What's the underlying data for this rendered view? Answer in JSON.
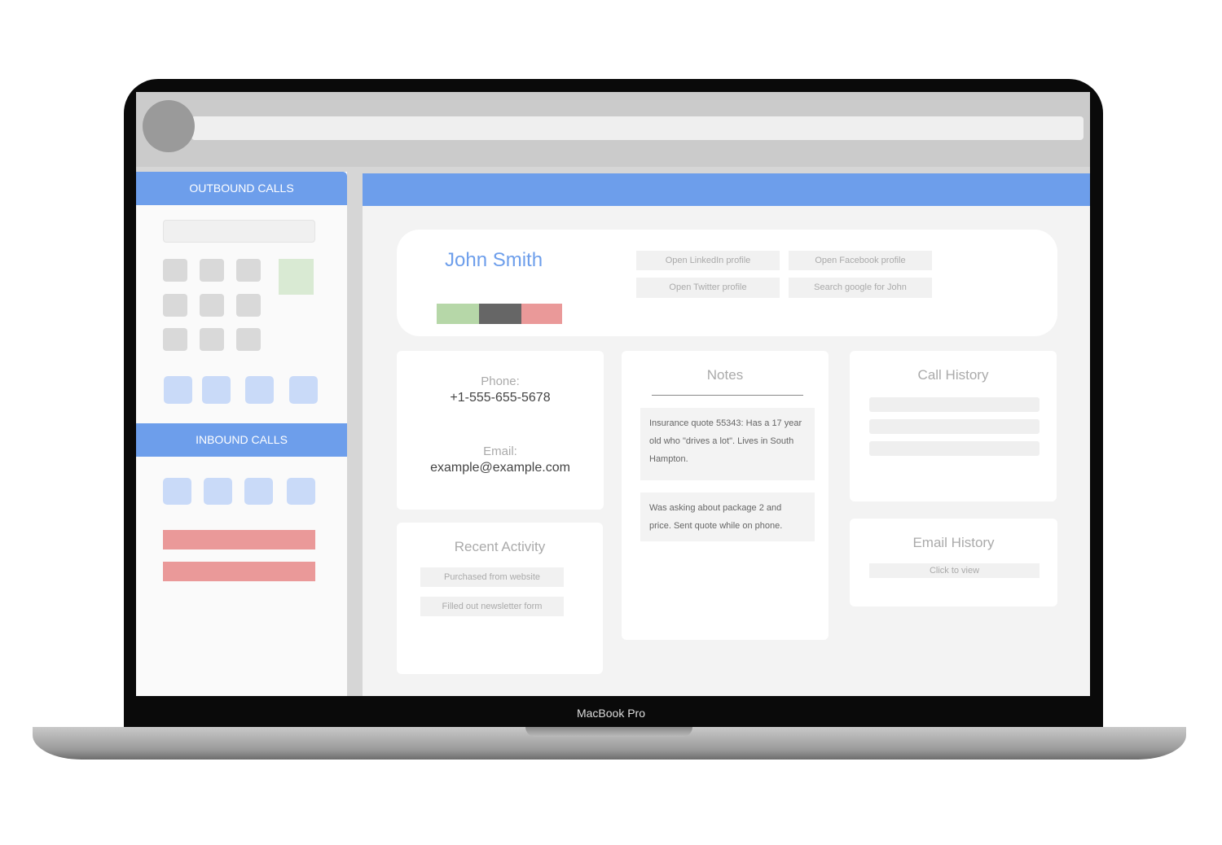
{
  "device": {
    "label": "MacBook Pro"
  },
  "sidebar": {
    "outbound_title": "OUTBOUND CALLS",
    "inbound_title": "INBOUND CALLS"
  },
  "contact": {
    "name": "John Smith",
    "status_colors": [
      "#b6d7a8",
      "#666666",
      "#ea9999"
    ],
    "buttons": [
      "Open LinkedIn profile",
      "Open Facebook profile",
      "Open Twitter profile",
      "Search google for John"
    ]
  },
  "details": {
    "phone_label": "Phone:",
    "phone": "+1-555-655-5678",
    "email_label": "Email:",
    "email": "example@example.com"
  },
  "notes": {
    "title": "Notes",
    "items": [
      "Insurance quote 55343: Has a 17 year old who \"drives a lot\". Lives in South Hampton.",
      "Was asking about package 2 and price. Sent quote while on phone."
    ]
  },
  "call_history": {
    "title": "Call History"
  },
  "email_history": {
    "title": "Email History",
    "button": "Click to view"
  },
  "recent_activity": {
    "title": "Recent Activity",
    "items": [
      "Purchased from website",
      "Filled out newsletter form"
    ]
  },
  "colors": {
    "accent": "#6d9eeb",
    "keypad_call": "#d9ead3",
    "danger": "#ea9999"
  }
}
